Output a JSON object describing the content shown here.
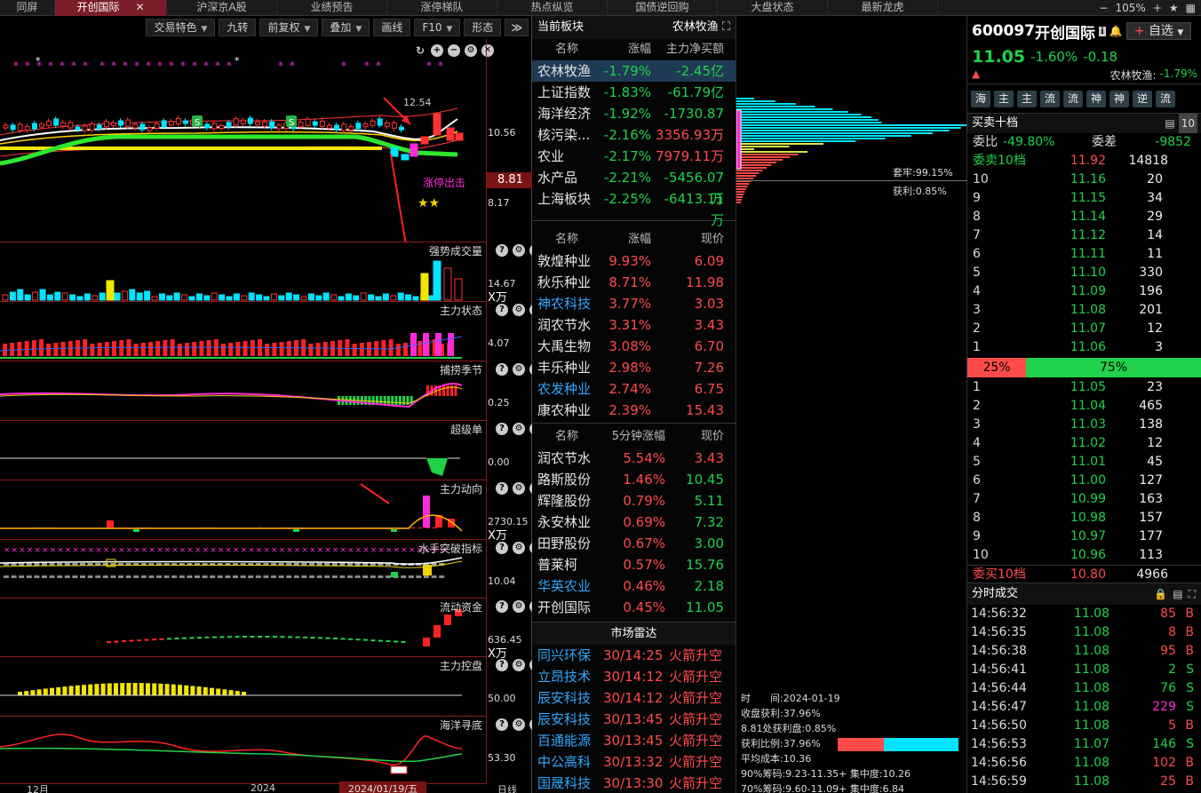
{
  "topnav": {
    "tabs": [
      "同屏",
      "开创国际",
      "沪深京A股",
      "业绩预告",
      "涨停梯队",
      "热点纵览",
      "国债逆回购",
      "大盘状态",
      "最新龙虎"
    ],
    "active_index": 1,
    "zoom": "105%"
  },
  "toolbar": {
    "items": [
      "交易特色",
      "九转",
      "前复权",
      "叠加",
      "画线",
      "F10",
      "形态"
    ]
  },
  "chart": {
    "main_axis": {
      "top": "10.56",
      "mark": "8.81",
      "low": "8.17"
    },
    "price_label": "12.54",
    "annotation": "涨停出击",
    "panels": [
      {
        "label": "强势成交量",
        "value": "14.67",
        "unit": "X万"
      },
      {
        "label": "主力状态",
        "value": "4.07",
        "unit": ""
      },
      {
        "label": "捕捞季节",
        "value": "0.25",
        "unit": ""
      },
      {
        "label": "超级单",
        "value": "0.00",
        "unit": ""
      },
      {
        "label": "主力动向",
        "value": "2730.15",
        "unit": "X万"
      },
      {
        "label": "水手突破指标",
        "value": "10.04",
        "unit": ""
      },
      {
        "label": "流动资金",
        "value": "636.45",
        "unit": "X万"
      },
      {
        "label": "主力控盘",
        "value": "50.00",
        "unit": ""
      },
      {
        "label": "海洋寻底",
        "value": "53.30",
        "unit": ""
      }
    ],
    "xaxis": {
      "left": "12月",
      "mid": "2024",
      "current": "2024/01/19/五",
      "period": "日线"
    }
  },
  "sector": {
    "title": "当前板块",
    "current": "农林牧渔",
    "head1": [
      "名称",
      "涨幅",
      "主力净买额"
    ],
    "rows1": [
      {
        "name": "农林牧渔",
        "pct": "-1.79%",
        "val": "-2.45亿",
        "hl": true
      },
      {
        "name": "上证指数",
        "pct": "-1.83%",
        "val": "-61.79亿"
      },
      {
        "name": "海洋经济",
        "pct": "-1.92%",
        "val": "-1730.87万"
      },
      {
        "name": "核污染...",
        "pct": "-2.16%",
        "val": "3356.93万"
      },
      {
        "name": "农业",
        "pct": "-2.17%",
        "val": "7979.11万"
      },
      {
        "name": "水产品",
        "pct": "-2.21%",
        "val": "-5456.07万"
      },
      {
        "name": "上海板块",
        "pct": "-2.25%",
        "val": "-6413.11万"
      }
    ],
    "head2": [
      "名称",
      "涨幅",
      "现价"
    ],
    "rows2": [
      {
        "name": "敦煌种业",
        "pct": "9.93%",
        "val": "6.09",
        "nc": "name"
      },
      {
        "name": "秋乐种业",
        "pct": "8.71%",
        "val": "11.98",
        "nc": "name"
      },
      {
        "name": "神农科技",
        "pct": "3.77%",
        "val": "3.03",
        "nc": "blue"
      },
      {
        "name": "润农节水",
        "pct": "3.31%",
        "val": "3.43",
        "nc": "name"
      },
      {
        "name": "大禹生物",
        "pct": "3.08%",
        "val": "6.70",
        "nc": "name"
      },
      {
        "name": "丰乐种业",
        "pct": "2.98%",
        "val": "7.26",
        "nc": "name"
      },
      {
        "name": "农发种业",
        "pct": "2.74%",
        "val": "6.75",
        "nc": "blue"
      },
      {
        "name": "康农种业",
        "pct": "2.39%",
        "val": "15.43",
        "nc": "name"
      }
    ],
    "head3": [
      "名称",
      "5分钟涨幅",
      "现价"
    ],
    "rows3": [
      {
        "name": "润农节水",
        "pct": "5.54%",
        "val": "3.43",
        "nc": "name",
        "vc": "up"
      },
      {
        "name": "路斯股份",
        "pct": "1.46%",
        "val": "10.45",
        "nc": "name",
        "vc": "dn"
      },
      {
        "name": "辉隆股份",
        "pct": "0.79%",
        "val": "5.11",
        "nc": "name",
        "vc": "dn"
      },
      {
        "name": "永安林业",
        "pct": "0.69%",
        "val": "7.32",
        "nc": "name",
        "vc": "dn"
      },
      {
        "name": "田野股份",
        "pct": "0.67%",
        "val": "3.00",
        "nc": "name",
        "vc": "dn"
      },
      {
        "name": "普莱柯",
        "pct": "0.57%",
        "val": "15.76",
        "nc": "name",
        "vc": "dn"
      },
      {
        "name": "华英农业",
        "pct": "0.46%",
        "val": "2.18",
        "nc": "blue",
        "vc": "dn"
      },
      {
        "name": "开创国际",
        "pct": "0.45%",
        "val": "11.05",
        "nc": "name",
        "vc": "dn"
      }
    ],
    "radar_title": "市场雷达",
    "radar": [
      {
        "name": "同兴环保",
        "time": "30/14:25",
        "evt": "火箭升空"
      },
      {
        "name": "立昂技术",
        "time": "30/14:12",
        "evt": "火箭升空"
      },
      {
        "name": "辰安科技",
        "time": "30/14:12",
        "evt": "火箭升空"
      },
      {
        "name": "辰安科技",
        "time": "30/13:45",
        "evt": "火箭升空"
      },
      {
        "name": "百通能源",
        "time": "30/13:45",
        "evt": "火箭升空"
      },
      {
        "name": "中公高科",
        "time": "30/13:32",
        "evt": "火箭升空"
      },
      {
        "name": "国晟科技",
        "time": "30/13:30",
        "evt": "火箭升空"
      }
    ]
  },
  "chips": {
    "trap": "套牢:99.15%",
    "profit": "获利:0.85%",
    "info": [
      "时　　间:2024-01-19",
      "收盘获利:37.96%",
      "8.81处获利盘:0.85%",
      "获利比例:37.96%",
      "平均成本:10.36",
      "90%筹码:9.23-11.35+ 集中度:10.26",
      "70%筹码:9.60-11.09+ 集中度:6.84"
    ],
    "profit_ratio": 0.3796
  },
  "book": {
    "code": "600097",
    "name": "开创国际",
    "price": "11.05",
    "pct": "-1.60%",
    "chg": "-0.18",
    "fav": "自选",
    "sector_line": "农林牧渔:",
    "sector_pct": "-1.79%",
    "badges": [
      "海",
      "主",
      "主",
      "流",
      "流",
      "神",
      "神",
      "逆",
      "流"
    ],
    "depth_title": "买卖十档",
    "depth_btn": "10",
    "wb_label": "委比",
    "wb": "-49.80%",
    "wc_label": "委差",
    "wc": "-9852",
    "sell10_label": "委卖10档",
    "sell10_price": "11.92",
    "sell10_vol": "14818",
    "asks": [
      {
        "l": "10",
        "p": "11.16",
        "v": "20"
      },
      {
        "l": "9",
        "p": "11.15",
        "v": "34"
      },
      {
        "l": "8",
        "p": "11.14",
        "v": "29"
      },
      {
        "l": "7",
        "p": "11.12",
        "v": "14"
      },
      {
        "l": "6",
        "p": "11.11",
        "v": "11"
      },
      {
        "l": "5",
        "p": "11.10",
        "v": "330"
      },
      {
        "l": "4",
        "p": "11.09",
        "v": "196"
      },
      {
        "l": "3",
        "p": "11.08",
        "v": "201"
      },
      {
        "l": "2",
        "p": "11.07",
        "v": "12"
      },
      {
        "l": "1",
        "p": "11.06",
        "v": "3"
      }
    ],
    "ratio_sell": "25%",
    "ratio_buy": "75%",
    "bids": [
      {
        "l": "1",
        "p": "11.05",
        "v": "23"
      },
      {
        "l": "2",
        "p": "11.04",
        "v": "465"
      },
      {
        "l": "3",
        "p": "11.03",
        "v": "138"
      },
      {
        "l": "4",
        "p": "11.02",
        "v": "12"
      },
      {
        "l": "5",
        "p": "11.01",
        "v": "45"
      },
      {
        "l": "6",
        "p": "11.00",
        "v": "127"
      },
      {
        "l": "7",
        "p": "10.99",
        "v": "163"
      },
      {
        "l": "8",
        "p": "10.98",
        "v": "157"
      },
      {
        "l": "9",
        "p": "10.97",
        "v": "177"
      },
      {
        "l": "10",
        "p": "10.96",
        "v": "113"
      }
    ],
    "buy10_label": "委买10档",
    "buy10_price": "10.80",
    "buy10_vol": "4966",
    "ticks_title": "分时成交",
    "ticks": [
      {
        "t": "14:56:32",
        "p": "11.08",
        "v": "85",
        "s": "B"
      },
      {
        "t": "14:56:35",
        "p": "11.08",
        "v": "8",
        "s": "B"
      },
      {
        "t": "14:56:38",
        "p": "11.08",
        "v": "95",
        "s": "B"
      },
      {
        "t": "14:56:41",
        "p": "11.08",
        "v": "2",
        "s": "S"
      },
      {
        "t": "14:56:44",
        "p": "11.08",
        "v": "76",
        "s": "S"
      },
      {
        "t": "14:56:47",
        "p": "11.08",
        "v": "229",
        "s": "S",
        "mag": true
      },
      {
        "t": "14:56:50",
        "p": "11.08",
        "v": "5",
        "s": "B"
      },
      {
        "t": "14:56:53",
        "p": "11.07",
        "v": "146",
        "s": "S"
      },
      {
        "t": "14:56:56",
        "p": "11.08",
        "v": "102",
        "s": "B"
      },
      {
        "t": "14:56:59",
        "p": "11.08",
        "v": "25",
        "s": "B"
      }
    ]
  },
  "colors": {
    "up": "#ff4a4a",
    "down": "#1fd24a",
    "blue": "#2fa8ff",
    "cyan": "#00e5ff",
    "magenta": "#ff2bd8",
    "yellow": "#f2d200"
  }
}
